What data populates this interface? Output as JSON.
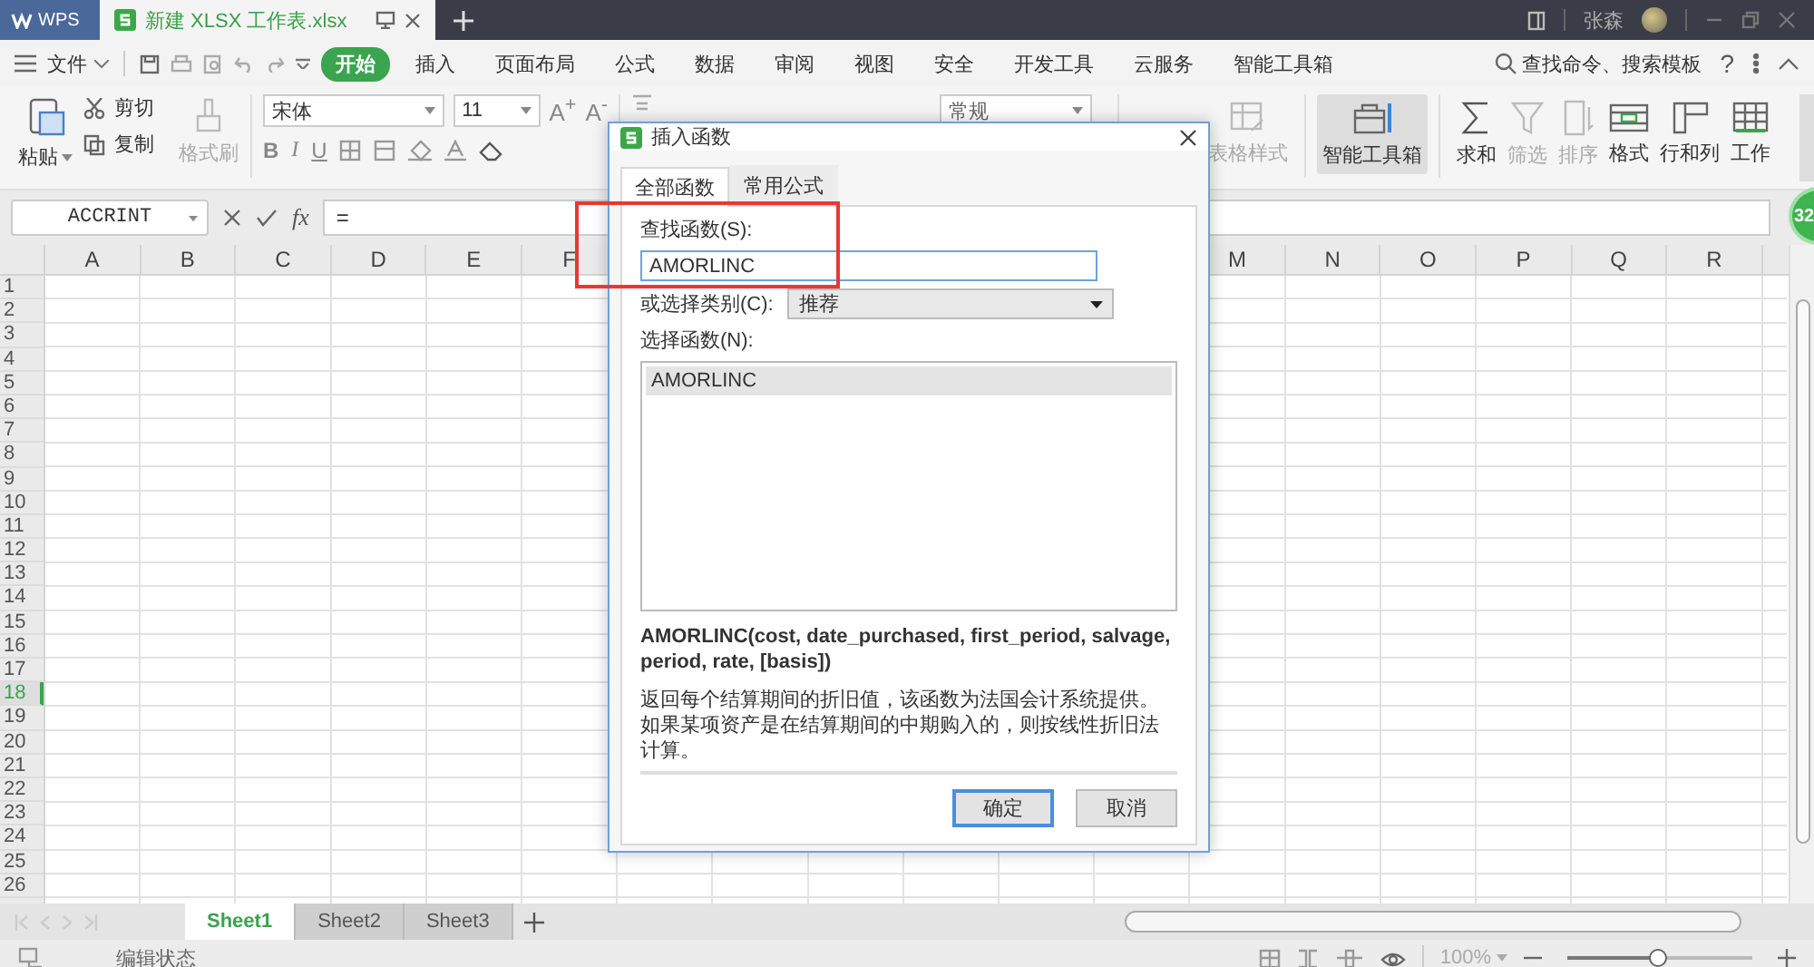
{
  "title_bar": {
    "app_tab": "WPS",
    "document_tab": "新建 XLSX 工作表.xlsx",
    "user_name": "张森"
  },
  "menu": {
    "file": "文件",
    "tabs": [
      {
        "label": "开始",
        "selected": true
      },
      {
        "label": "插入",
        "selected": false
      },
      {
        "label": "页面布局",
        "selected": false
      },
      {
        "label": "公式",
        "selected": false
      },
      {
        "label": "数据",
        "selected": false
      },
      {
        "label": "审阅",
        "selected": false
      },
      {
        "label": "视图",
        "selected": false
      },
      {
        "label": "安全",
        "selected": false
      },
      {
        "label": "开发工具",
        "selected": false
      },
      {
        "label": "云服务",
        "selected": false
      },
      {
        "label": "智能工具箱",
        "selected": false
      }
    ],
    "search": "查找命令、搜索模板",
    "help": "?"
  },
  "ribbon": {
    "paste": "粘贴",
    "cut": "剪切",
    "copy": "复制",
    "format_painter": {
      "label": "格式刷",
      "disabled": true
    },
    "font_name": "宋体",
    "font_size": "11",
    "size_buttons": [
      "A$^{+}$",
      "A$^{-}$"
    ],
    "style_buttons": [
      {
        "label": "B",
        "kind": "bold"
      },
      {
        "label": "I",
        "kind": "italic"
      },
      {
        "label": "U",
        "kind": "underline"
      }
    ],
    "number_format": "常规",
    "tools": [
      {
        "kind": "table-style",
        "label": "表格样式",
        "disabled": true,
        "pressed": false
      },
      {
        "kind": "toolbox",
        "label": "智能工具箱",
        "disabled": false,
        "pressed": true
      },
      {
        "kind": "sum",
        "label": "求和",
        "disabled": false,
        "pressed": false
      },
      {
        "kind": "filter",
        "label": "筛选",
        "disabled": true,
        "pressed": false
      },
      {
        "kind": "sort",
        "label": "排序",
        "disabled": true,
        "pressed": false
      },
      {
        "kind": "format",
        "label": "格式",
        "disabled": false,
        "pressed": false
      },
      {
        "kind": "rowcol",
        "label": "行和列",
        "disabled": false,
        "pressed": false
      },
      {
        "kind": "sheet",
        "label": "工作",
        "disabled": false,
        "pressed": false
      }
    ]
  },
  "formula_bar": {
    "name_box": "ACCRINT",
    "function_label": "fx",
    "formula": "="
  },
  "badge": "32",
  "sheet": {
    "columns_left": [
      "A",
      "B",
      "C",
      "D",
      "E",
      "F"
    ],
    "columns_right": [
      "M",
      "N",
      "O",
      "P",
      "Q",
      "R"
    ],
    "rows": [
      {
        "label": "1",
        "selected": false
      },
      {
        "label": "2",
        "selected": false
      },
      {
        "label": "3",
        "selected": false
      },
      {
        "label": "4",
        "selected": false
      },
      {
        "label": "5",
        "selected": false
      },
      {
        "label": "6",
        "selected": false
      },
      {
        "label": "7",
        "selected": false
      },
      {
        "label": "8",
        "selected": false
      },
      {
        "label": "9",
        "selected": false
      },
      {
        "label": "10",
        "selected": false
      },
      {
        "label": "11",
        "selected": false
      },
      {
        "label": "12",
        "selected": false
      },
      {
        "label": "13",
        "selected": false
      },
      {
        "label": "14",
        "selected": false
      },
      {
        "label": "15",
        "selected": false
      },
      {
        "label": "16",
        "selected": false
      },
      {
        "label": "17",
        "selected": false
      },
      {
        "label": "18",
        "selected": true
      },
      {
        "label": "19",
        "selected": false
      },
      {
        "label": "20",
        "selected": false
      },
      {
        "label": "21",
        "selected": false
      },
      {
        "label": "22",
        "selected": false
      },
      {
        "label": "23",
        "selected": false
      },
      {
        "label": "24",
        "selected": false
      },
      {
        "label": "25",
        "selected": false
      },
      {
        "label": "26",
        "selected": false
      }
    ]
  },
  "sheet_tabs": [
    {
      "label": "Sheet1",
      "selected": true
    },
    {
      "label": "Sheet2",
      "selected": false
    },
    {
      "label": "Sheet3",
      "selected": false
    }
  ],
  "status_bar": {
    "mode": "编辑状态",
    "zoom": "100%",
    "zoom_slider": {
      "level": 0.49
    }
  },
  "dialog": {
    "title": "插入函数",
    "tabs": [
      {
        "label": "全部函数",
        "selected": true
      },
      {
        "label": "常用公式",
        "selected": false
      }
    ],
    "search_label": "查找函数(S):",
    "search_value": "AMORLINC",
    "category_label": "或选择类别(C):",
    "category_value": "推荐",
    "list_label": "选择函数(N):",
    "functions": [
      {
        "name": "AMORLINC",
        "selected": true
      }
    ],
    "signature": "AMORLINC(cost, date_purchased, first_period, salvage, period, rate, [basis])",
    "description": "返回每个结算期间的折旧值，该函数为法国会计系统提供。如果某项资产是在结算期间的中期购入的，则按线性折旧法计算。",
    "buttons": [
      {
        "label": "确定",
        "default": true
      },
      {
        "label": "取消",
        "default": false
      }
    ]
  }
}
